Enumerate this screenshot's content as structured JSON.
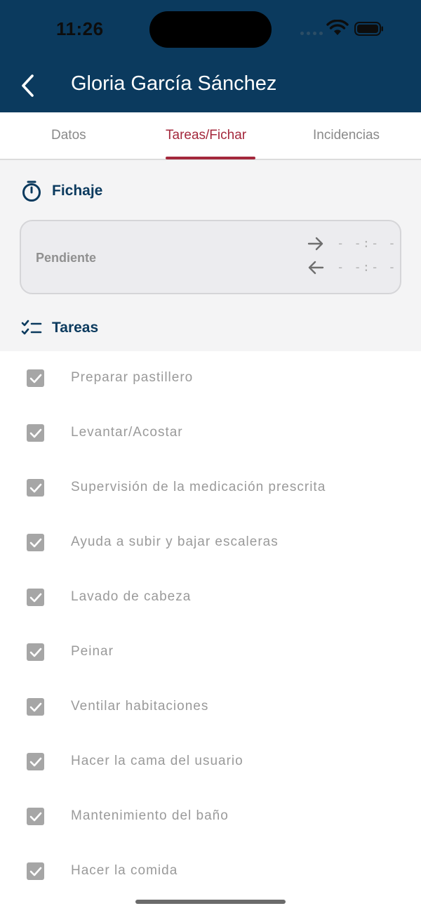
{
  "status_bar": {
    "time": "11:26"
  },
  "header": {
    "title": "Gloria García Sánchez",
    "background_color": "#0b3a5e"
  },
  "tabs": [
    {
      "label": "Datos",
      "active": false
    },
    {
      "label": "Tareas/Fichar",
      "active": true
    },
    {
      "label": "Incidencias",
      "active": false
    }
  ],
  "accent_color": "#a4283c",
  "fichaje": {
    "heading": "Fichaje",
    "icon": "stopwatch-icon",
    "status": "Pendiente",
    "entrada_time": "- -:- -",
    "salida_time": "- -:- -"
  },
  "tareas": {
    "heading": "Tareas",
    "icon": "checklist-icon",
    "items": [
      {
        "label": "Preparar pastillero",
        "checked": true
      },
      {
        "label": "Levantar/Acostar",
        "checked": true
      },
      {
        "label": "Supervisión de la medicación prescrita",
        "checked": true
      },
      {
        "label": "Ayuda a subir y bajar escaleras",
        "checked": true
      },
      {
        "label": "Lavado de cabeza",
        "checked": true
      },
      {
        "label": "Peinar",
        "checked": true
      },
      {
        "label": "Ventilar habitaciones",
        "checked": true
      },
      {
        "label": "Hacer la cama del usuario",
        "checked": true
      },
      {
        "label": "Mantenimiento del baño",
        "checked": true
      },
      {
        "label": "Hacer la comida",
        "checked": true
      }
    ]
  }
}
